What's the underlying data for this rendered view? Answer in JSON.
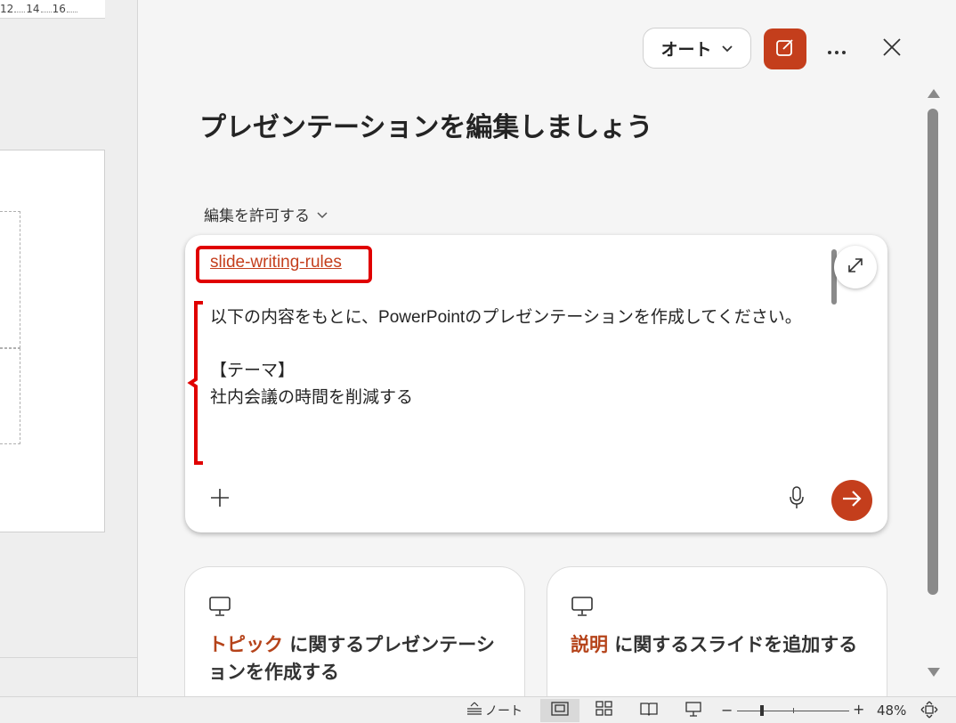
{
  "ruler": {
    "numbers": [
      "12",
      "14",
      "16"
    ]
  },
  "panel": {
    "mode_label": "オート",
    "title": "プレゼンテーションを編集しましょう",
    "permission_label": "編集を許可する"
  },
  "composer": {
    "skill_link": "slide-writing-rules",
    "prompt_text": "以下の内容をもとに、PowerPointのプレゼンテーションを作成してください。\n\n【テーマ】\n社内会議の時間を削減する"
  },
  "suggestions": [
    {
      "accent": "トピック",
      "text": " に関するプレゼンテーションを作成する"
    },
    {
      "accent": "説明",
      "text": " に関するスライドを追加する"
    }
  ],
  "status_bar": {
    "notes_label": "ノート",
    "zoom_level": "48%"
  },
  "colors": {
    "accent": "#c43e1c",
    "highlight": "#e00000"
  },
  "icons": [
    "chevron-down-icon",
    "edit-icon",
    "more-icon",
    "close-icon",
    "expand-icon",
    "plus-icon",
    "mic-icon",
    "arrow-right-icon",
    "presentation-icon",
    "notes-icon",
    "normal-view-icon",
    "sorter-view-icon",
    "reading-view-icon",
    "slideshow-icon",
    "fit-window-icon"
  ]
}
